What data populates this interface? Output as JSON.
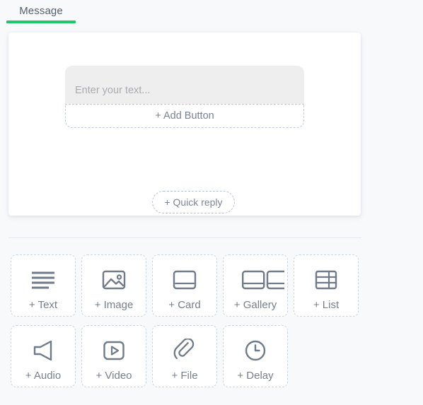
{
  "tabs": [
    {
      "label": "Message",
      "active": true,
      "accent": "#20c76a"
    }
  ],
  "message_card": {
    "text_input": {
      "value": "",
      "placeholder": "Enter your text..."
    },
    "add_button_label": "+ Add Button",
    "quick_reply_label": "+ Quick reply"
  },
  "elements": {
    "rows": [
      [
        {
          "label": "+ Text",
          "icon": "text-lines-icon"
        },
        {
          "label": "+ Image",
          "icon": "image-icon"
        },
        {
          "label": "+ Card",
          "icon": "card-icon"
        },
        {
          "label": "+ Gallery",
          "icon": "gallery-icon"
        },
        {
          "label": "+ List",
          "icon": "list-grid-icon"
        }
      ],
      [
        {
          "label": "+ Audio",
          "icon": "speaker-icon"
        },
        {
          "label": "+ Video",
          "icon": "play-icon"
        },
        {
          "label": "+ File",
          "icon": "paperclip-icon"
        },
        {
          "label": "+ Delay",
          "icon": "clock-icon"
        }
      ]
    ]
  },
  "colors": {
    "accent_green": "#20c76a",
    "page_background": "#f7f9fb",
    "card_background": "#ffffff",
    "input_background": "#eeeeee",
    "dashed_border": "#ccd5e2",
    "icon_stroke": "#707a88",
    "label_text": "#767f8c"
  }
}
